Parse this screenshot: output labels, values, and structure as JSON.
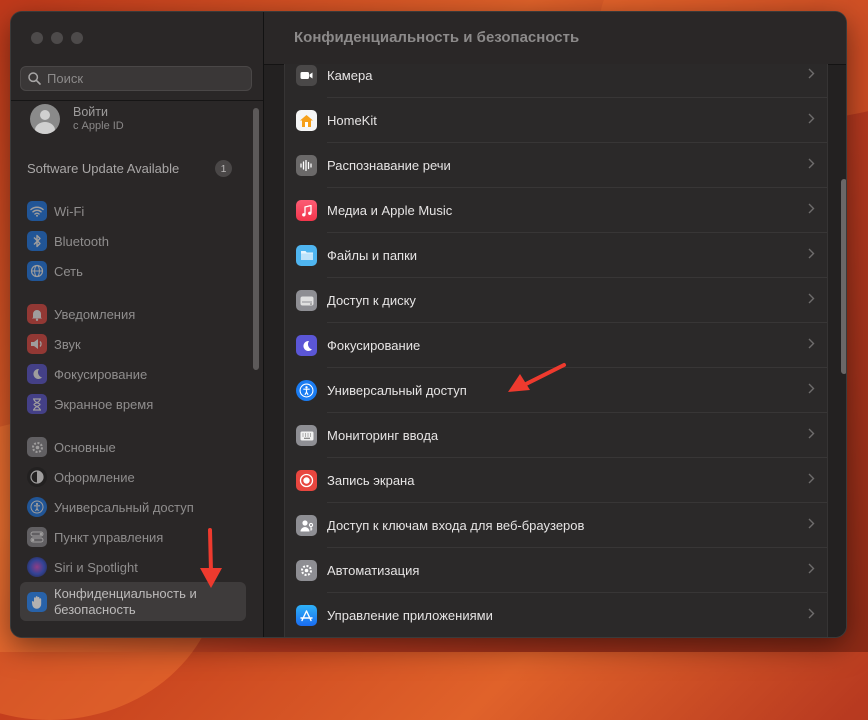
{
  "colors": {
    "accent_arrow": "#ee3a2e",
    "window_bg": "#1e1e1e"
  },
  "sidebar": {
    "search": {
      "placeholder": "Поиск",
      "icon": "search-icon"
    },
    "account": {
      "name": "Войти",
      "subtitle": "с Apple ID"
    },
    "update": {
      "label": "Software Update Available",
      "count": "1"
    },
    "items": [
      {
        "label": "Wi-Fi",
        "icon": "wifi-icon",
        "color": "#1a7cf2"
      },
      {
        "label": "Bluetooth",
        "icon": "bluetooth-icon",
        "color": "#1a7cf2"
      },
      {
        "label": "Сеть",
        "icon": "globe-icon",
        "color": "#1a7cf2"
      },
      {
        "label": "Уведомления",
        "icon": "bell-icon",
        "color": "#e8463f"
      },
      {
        "label": "Звук",
        "icon": "speaker-icon",
        "color": "#e8463f"
      },
      {
        "label": "Фокусирование",
        "icon": "moon-icon",
        "color": "#5b56d6"
      },
      {
        "label": "Экранное время",
        "icon": "hourglass-icon",
        "color": "#5b56d6"
      },
      {
        "label": "Основные",
        "icon": "gear-icon",
        "color": "#8e8e93"
      },
      {
        "label": "Оформление",
        "icon": "appearance-icon",
        "color": "#1c1c1c"
      },
      {
        "label": "Универсальный доступ",
        "icon": "accessibility-icon",
        "color": "#1a7cf2"
      },
      {
        "label": "Пункт управления",
        "icon": "control-center-icon",
        "color": "#8e8e93"
      },
      {
        "label": "Siri и Spotlight",
        "icon": "siri-icon",
        "color": "#2a2a6a"
      },
      {
        "label": "Конфиденциальность и безопасность",
        "icon": "hand-icon",
        "color": "#1a7cf2"
      }
    ]
  },
  "main": {
    "title": "Конфиденциальность и безопасность",
    "rows": [
      {
        "label": "Камера",
        "icon": "camera-icon",
        "color": "#4a4848"
      },
      {
        "label": "HomeKit",
        "icon": "home-icon",
        "color": "#f5f5f5"
      },
      {
        "label": "Распознавание речи",
        "icon": "waveform-icon",
        "color": "#6b6969"
      },
      {
        "label": "Медиа и Apple Music",
        "icon": "music-icon",
        "color": "#f2405a"
      },
      {
        "label": "Файлы и папки",
        "icon": "folder-icon",
        "color": "#4fb5f0"
      },
      {
        "label": "Доступ к диску",
        "icon": "disk-icon",
        "color": "#8e8e93"
      },
      {
        "label": "Фокусирование",
        "icon": "moon-icon",
        "color": "#5b56d6"
      },
      {
        "label": "Универсальный доступ",
        "icon": "accessibility-icon",
        "color": "#1a7cf2"
      },
      {
        "label": "Мониторинг ввода",
        "icon": "keyboard-icon",
        "color": "#8e8e93"
      },
      {
        "label": "Запись экрана",
        "icon": "record-icon",
        "color": "#e8463f"
      },
      {
        "label": "Доступ к ключам входа для веб-браузеров",
        "icon": "person-key-icon",
        "color": "#8e8e93"
      },
      {
        "label": "Автоматизация",
        "icon": "gear-icon",
        "color": "#8e8e93"
      },
      {
        "label": "Управление приложениями",
        "icon": "app-store-icon",
        "color": "#1a7cf2"
      }
    ]
  }
}
